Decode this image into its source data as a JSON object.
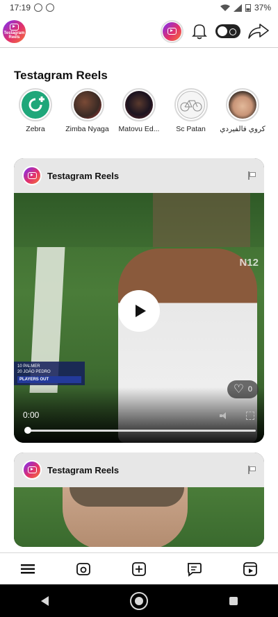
{
  "status_bar": {
    "time": "17:19",
    "battery": "37%"
  },
  "app": {
    "logo_line1": "Testagram",
    "logo_line2": "Reels"
  },
  "section": {
    "title": "Testagram Reels"
  },
  "stories": [
    {
      "label": "Zebra"
    },
    {
      "label": "Zimba Nyaga"
    },
    {
      "label": "Matovu Ed..."
    },
    {
      "label": "Sc Patan"
    },
    {
      "label": "كروي فالفيردي"
    }
  ],
  "posts": [
    {
      "author": "Testagram Reels",
      "broadcaster_logo": "N12",
      "lower_third": {
        "line1": "10 PALMER",
        "line2": "20 JOÃO PEDRO",
        "tag": "PLAYERS OUT"
      },
      "time": "0:00",
      "likes": "0",
      "progress": 0
    },
    {
      "author": "Testagram Reels"
    }
  ],
  "icons": {
    "bell": "bell-icon",
    "toggle": "dark-mode-toggle",
    "share": "share-icon",
    "menu": "menu-icon",
    "camera": "camera-icon",
    "add": "add-icon",
    "comments": "comments-icon",
    "reels": "reels-icon",
    "heart": "heart-icon"
  }
}
